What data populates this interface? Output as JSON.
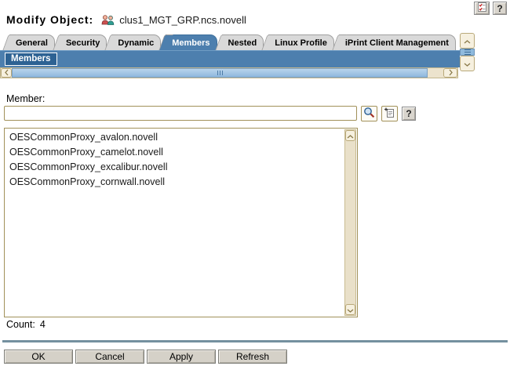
{
  "header": {
    "title": "Modify Object:",
    "object_name": "clus1_MGT_GRP.ncs.novell",
    "help_label": "?"
  },
  "tabs": {
    "items": [
      {
        "label": "General",
        "active": false
      },
      {
        "label": "Security",
        "active": false
      },
      {
        "label": "Dynamic",
        "active": false
      },
      {
        "label": "Members",
        "active": true
      },
      {
        "label": "Nested",
        "active": false
      },
      {
        "label": "Linux Profile",
        "active": false
      },
      {
        "label": "iPrint Client Management",
        "active": false
      }
    ]
  },
  "members_bar": {
    "label": "Members"
  },
  "form": {
    "member_label": "Member:",
    "member_value": "",
    "help_label": "?"
  },
  "member_list": {
    "items": [
      "OESCommonProxy_avalon.novell",
      "OESCommonProxy_camelot.novell",
      "OESCommonProxy_excalibur.novell",
      "OESCommonProxy_cornwall.novell"
    ],
    "count_label": "Count:",
    "count_value": "4"
  },
  "footer": {
    "buttons": [
      "OK",
      "Cancel",
      "Apply",
      "Refresh"
    ]
  },
  "colors": {
    "active_tab_blue": "#4d7fae",
    "members_chip_blue": "#2d6293",
    "inactive_tab_gray": "#d9d9d9",
    "field_border_tan": "#a1915a",
    "scrollbar_beige": "#ece3cd",
    "scrollbar_thumb_blue": "#8fbadd",
    "divider_blue_gray": "#74909f",
    "button_face_gray": "#d5d1c8"
  }
}
